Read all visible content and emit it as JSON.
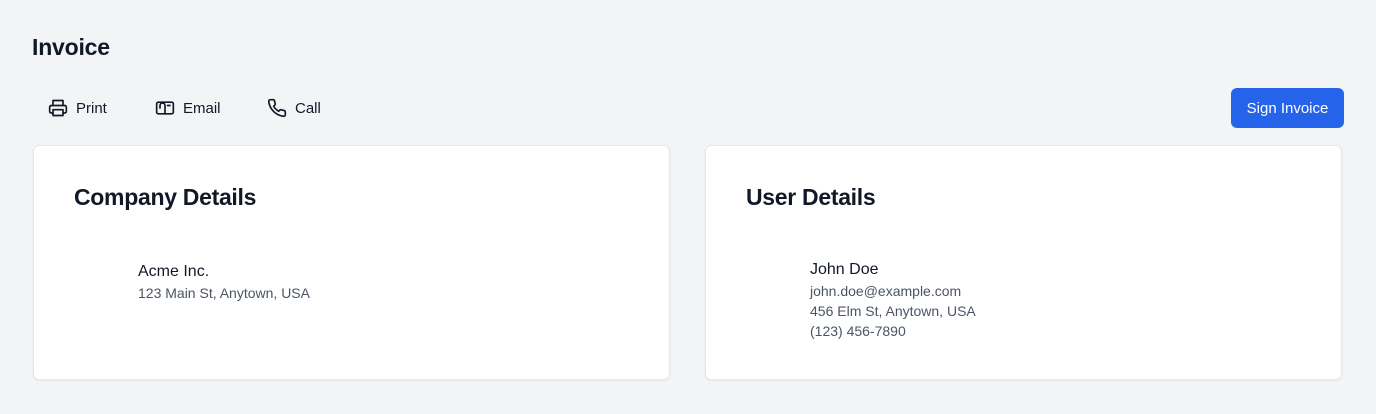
{
  "page": {
    "title": "Invoice"
  },
  "toolbar": {
    "actions": [
      {
        "label": "Print",
        "icon": "printer-icon"
      },
      {
        "label": "Email",
        "icon": "mail-icon"
      },
      {
        "label": "Call",
        "icon": "phone-icon"
      }
    ],
    "primary_label": "Sign Invoice"
  },
  "company": {
    "heading": "Company Details",
    "name": "Acme Inc.",
    "address": "123 Main St, Anytown, USA"
  },
  "user": {
    "heading": "User Details",
    "name": "John Doe",
    "email": "john.doe@example.com",
    "address": "456 Elm St, Anytown, USA",
    "phone": "(123) 456-7890"
  },
  "colors": {
    "background": "#f3f4f6",
    "accent": "#2563eb",
    "card": "#ffffff",
    "text": "#111827",
    "muted_text": "#4b5563"
  }
}
